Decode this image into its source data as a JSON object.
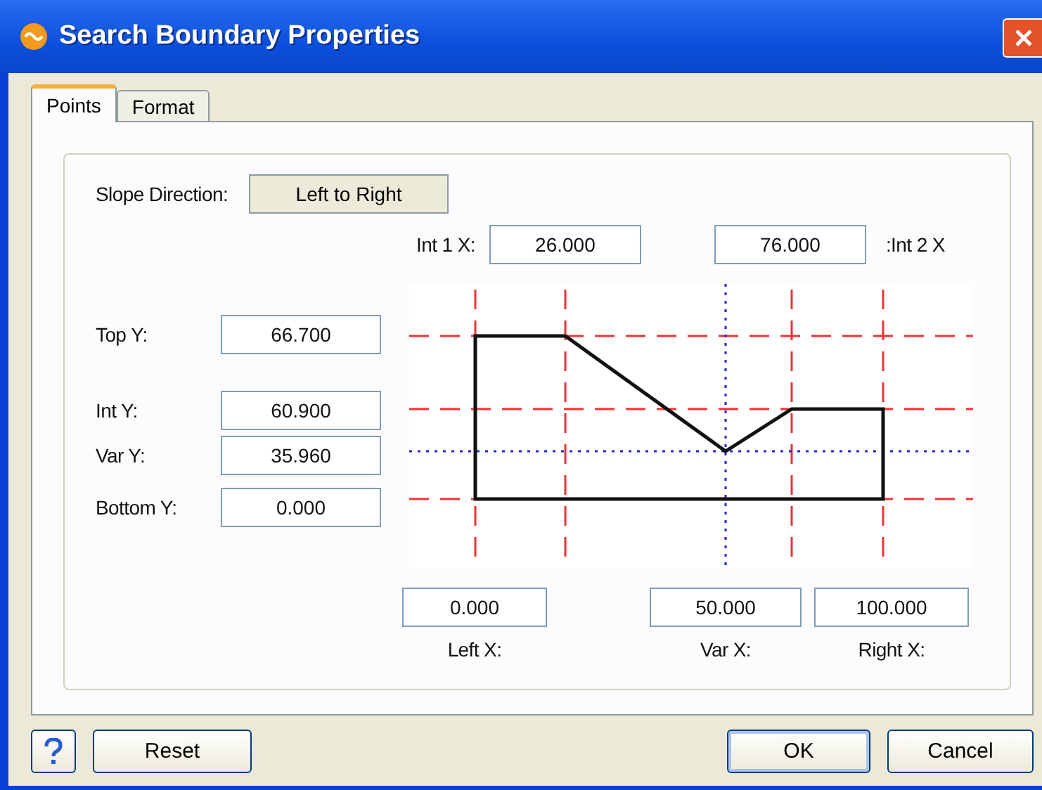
{
  "window": {
    "title": "Search Boundary Properties"
  },
  "tabs": [
    {
      "label": "Points",
      "selected": true
    },
    {
      "label": "Format",
      "selected": false
    }
  ],
  "slope_direction": {
    "label": "Slope Direction:",
    "value": "Left to Right"
  },
  "int_1_x": {
    "label": "Int 1 X:",
    "value": "26.000"
  },
  "int_2_x": {
    "label": ":Int 2 X",
    "value": "76.000"
  },
  "y_fields": [
    {
      "label": "Top Y:",
      "value": "66.700"
    },
    {
      "label": "Int Y:",
      "value": "60.900"
    },
    {
      "label": "Var Y:",
      "value": "35.960"
    },
    {
      "label": "Bottom Y:",
      "value": "0.000"
    }
  ],
  "x_fields": [
    {
      "label": "Left X:",
      "value": "0.000"
    },
    {
      "label": "Var X:",
      "value": "50.000"
    },
    {
      "label": "Right X:",
      "value": "100.000"
    }
  ],
  "buttons": {
    "reset": "Reset",
    "ok": "OK",
    "cancel": "Cancel"
  }
}
